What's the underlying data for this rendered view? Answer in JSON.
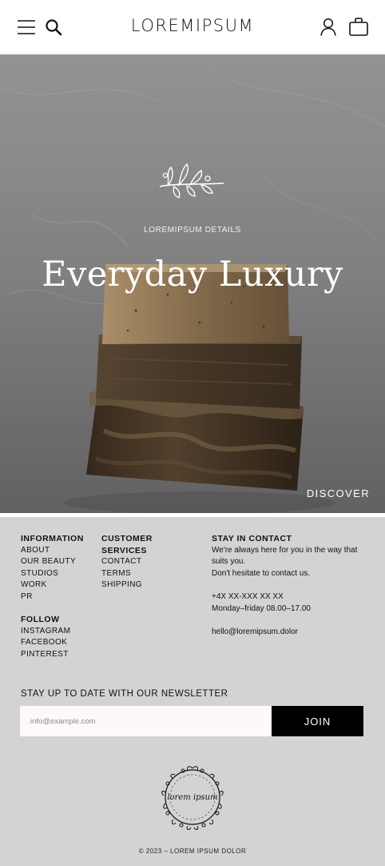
{
  "header": {
    "logo": "LOREMIPSUM",
    "icons": [
      "menu-icon",
      "search-icon",
      "account-icon",
      "bag-icon"
    ]
  },
  "hero": {
    "kicker": "LOREMIPSUM DETAILS",
    "title": "Everyday Luxury",
    "discover": "DISCOVER",
    "icon": "sprig-icon"
  },
  "footer": {
    "information": {
      "heading": "INFORMATION",
      "links": [
        "ABOUT",
        "OUR BEAUTY",
        "STUDIOS",
        "WORK",
        "PR"
      ]
    },
    "follow": {
      "heading": "FOLLOW",
      "links": [
        "INSTAGRAM",
        "FACEBOOK",
        "PINTEREST"
      ]
    },
    "services": {
      "heading_line1": "CUSTOMER",
      "heading_line2": "SERVICES",
      "links": [
        "CONTACT",
        "TERMS",
        "SHIPPING"
      ]
    },
    "contact": {
      "heading": "STAY IN CONTACT",
      "line1": "We're always here for you in the way that",
      "line2": "suits you.",
      "line3": "Don't hesitate to contact us.",
      "phone": "+4X XX-XXX XX XX",
      "hours": "Monday–friday 08.00–17.00",
      "email": "hello@loremipsum.dolor"
    },
    "newsletter": {
      "label": "STAY UP TO DATE WITH OUR NEWSLETTER",
      "placeholder": "info@example.com",
      "button": "JOIN"
    },
    "badge_text": "lorem ipsum",
    "copyright": "© 2023 – LOREM IPSUM DOLOR"
  }
}
